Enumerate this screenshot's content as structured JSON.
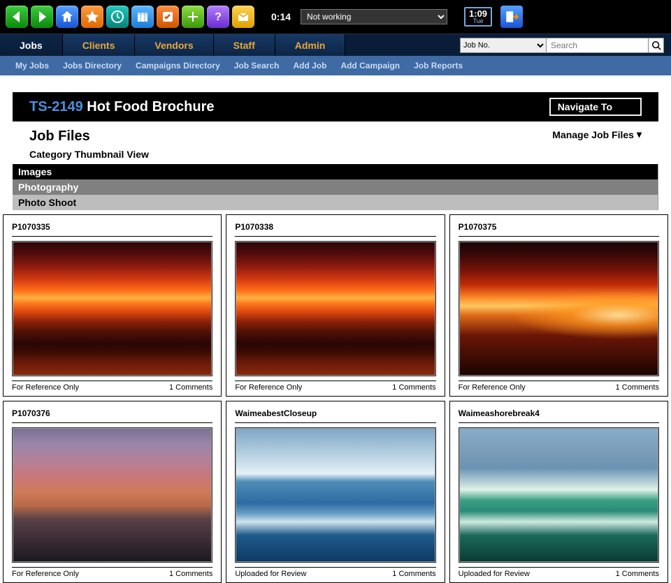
{
  "toolbar": {
    "time_elapsed": "0:14",
    "status_selected": "Not working",
    "clock_time": "1:09",
    "clock_day": "Tue"
  },
  "main_tabs": [
    {
      "label": "Jobs",
      "active": true
    },
    {
      "label": "Clients",
      "active": false
    },
    {
      "label": "Vendors",
      "active": false
    },
    {
      "label": "Staff",
      "active": false
    },
    {
      "label": "Admin",
      "active": false
    }
  ],
  "search": {
    "selector": "Job No.",
    "placeholder": "Search"
  },
  "subnav": [
    {
      "label": "My Jobs"
    },
    {
      "label": "Jobs Directory"
    },
    {
      "label": "Campaigns Directory"
    },
    {
      "label": "Job Search"
    },
    {
      "label": "Add Job"
    },
    {
      "label": "Add Campaign"
    },
    {
      "label": "Job Reports"
    }
  ],
  "page": {
    "code": "TS-2149",
    "name": "Hot Food Brochure",
    "navigate_label": "Navigate To",
    "section_title": "Job Files",
    "view_label": "Category Thumbnail View",
    "manage_label": "Manage Job Files"
  },
  "categories": [
    {
      "level": 1,
      "label": "Images"
    },
    {
      "level": 2,
      "label": "Photography"
    },
    {
      "level": 3,
      "label": "Photo Shoot"
    }
  ],
  "thumbnails": [
    [
      {
        "name": "P1070335",
        "status": "For Reference Only",
        "comments": "1 Comments",
        "cls": "sunset1"
      },
      {
        "name": "P1070338",
        "status": "For Reference Only",
        "comments": "1 Comments",
        "cls": "sunset1"
      },
      {
        "name": "P1070375",
        "status": "For Reference Only",
        "comments": "1 Comments",
        "cls": "sunset1r"
      }
    ],
    [
      {
        "name": "P1070376",
        "status": "For Reference Only",
        "comments": "1 Comments",
        "cls": "sunset2"
      },
      {
        "name": "WaimeabestCloseup",
        "status": "Uploaded for Review",
        "comments": "1 Comments",
        "cls": "wave1"
      },
      {
        "name": "Waimeashorebreak4",
        "status": "Uploaded for Review",
        "comments": "1 Comments",
        "cls": "wave2"
      }
    ]
  ]
}
